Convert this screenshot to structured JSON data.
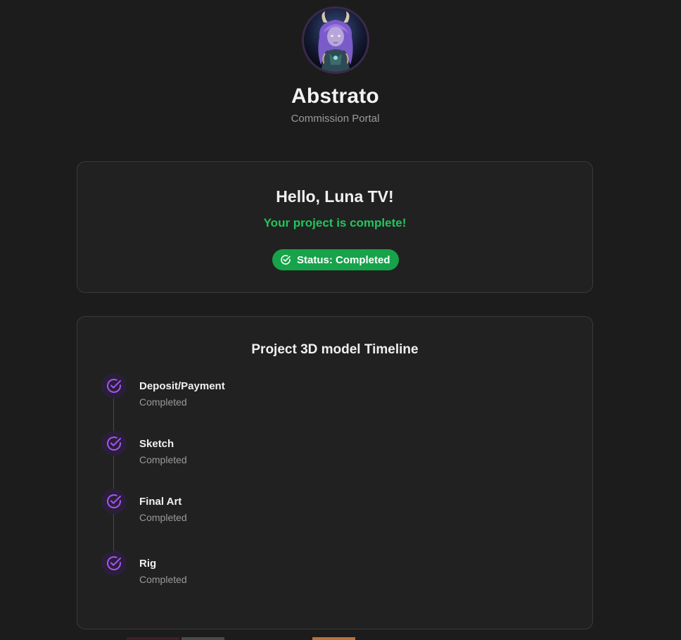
{
  "header": {
    "brand_name": "Abstrato",
    "subtitle": "Commission Portal",
    "avatar_icon": "character-avatar-icon"
  },
  "greeting": {
    "title": "Hello, Luna TV!",
    "message": "Your project is complete!",
    "status_badge": "Status: Completed",
    "status_icon": "check-circle-icon"
  },
  "timeline": {
    "title": "Project 3D model Timeline",
    "steps": [
      {
        "label": "Deposit/Payment",
        "status": "Completed"
      },
      {
        "label": "Sketch",
        "status": "Completed"
      },
      {
        "label": "Final Art",
        "status": "Completed"
      },
      {
        "label": "Rig",
        "status": "Completed"
      }
    ],
    "step_icon": "check-circle-icon"
  },
  "colors": {
    "background": "#1c1c1c",
    "card": "#212121",
    "success": "#22c55e",
    "badge": "#16a34a",
    "accent": "#a855f7"
  }
}
